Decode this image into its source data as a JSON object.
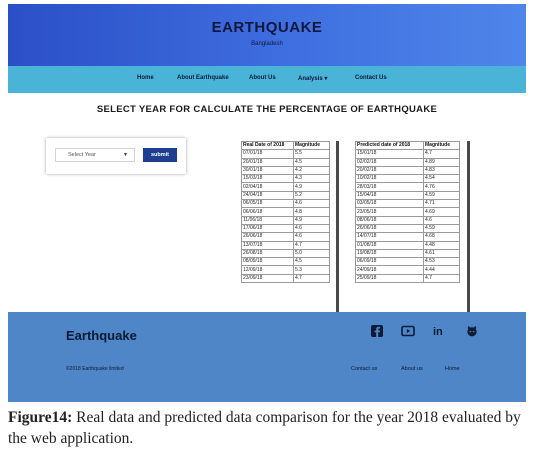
{
  "header": {
    "title": "EARTHQUAKE",
    "subtitle": "Bangladesh"
  },
  "nav": {
    "items": [
      "Home",
      "About Earthquake",
      "About Us",
      "Analysis",
      "Contact Us"
    ],
    "dropdown_indicator": "▾"
  },
  "main": {
    "heading": "SELECT YEAR FOR CALCULATE THE PERCENTAGE OF EARTHQUAKE",
    "form": {
      "select_value": "Select Year",
      "submit_label": "submit"
    }
  },
  "real_table": {
    "headers": [
      "Real Date of 2018",
      "Magnitude"
    ],
    "rows": [
      [
        "07/01/18",
        "5.5"
      ],
      [
        "20/01/18",
        "4.5"
      ],
      [
        "30/01/18",
        "4.2"
      ],
      [
        "15/03/18",
        "4.3"
      ],
      [
        "02/04/18",
        "4.9"
      ],
      [
        "24/04/18",
        "5.2"
      ],
      [
        "06/05/18",
        "4.6"
      ],
      [
        "06/06/18",
        "4.8"
      ],
      [
        "11/06/18",
        "4.9"
      ],
      [
        "17/06/18",
        "4.6"
      ],
      [
        "26/06/18",
        "4.6"
      ],
      [
        "13/07/18",
        "4.7"
      ],
      [
        "26/08/18",
        "5.0"
      ],
      [
        "08/09/18",
        "4.5"
      ],
      [
        "12/09/18",
        "5.3"
      ],
      [
        "23/09/18",
        "4.7"
      ]
    ]
  },
  "predicted_table": {
    "headers": [
      "Predicted date of 2018",
      "Magnitude"
    ],
    "rows": [
      [
        "15/01/18",
        "4.7"
      ],
      [
        "02/02/18",
        "4.89"
      ],
      [
        "20/02/18",
        "4.83"
      ],
      [
        "10/02/18",
        "4.54"
      ],
      [
        "28/03/18",
        "4.76"
      ],
      [
        "15/04/18",
        "4.59"
      ],
      [
        "03/05/18",
        "4.71"
      ],
      [
        "23/05/18",
        "4.69"
      ],
      [
        "08/06/18",
        "4.6"
      ],
      [
        "26/06/18",
        "4.59"
      ],
      [
        "14/07/18",
        "4.68"
      ],
      [
        "01/08/18",
        "4.48"
      ],
      [
        "19/08/18",
        "4.61"
      ],
      [
        "06/09/18",
        "4.53"
      ],
      [
        "24/09/18",
        "4.44"
      ],
      [
        "25/09/18",
        "4.7"
      ]
    ]
  },
  "footer": {
    "brand": "Earthquake",
    "copyright": "©2018 Earthquake limited",
    "links": [
      "Contact us",
      "About us",
      "Home"
    ],
    "social_icons": [
      "facebook-icon",
      "youtube-icon",
      "linkedin-icon",
      "github-icon"
    ],
    "linkedin_text": "in"
  },
  "caption": {
    "label": "Figure14:",
    "text": " Real data and predicted data comparison for the year 2018 evaluated by the web application."
  },
  "colors": {
    "banner": "#3f6fe0",
    "navbar": "#4ab3d8",
    "footer": "#4e86c7",
    "submit": "#1e3f8f"
  }
}
